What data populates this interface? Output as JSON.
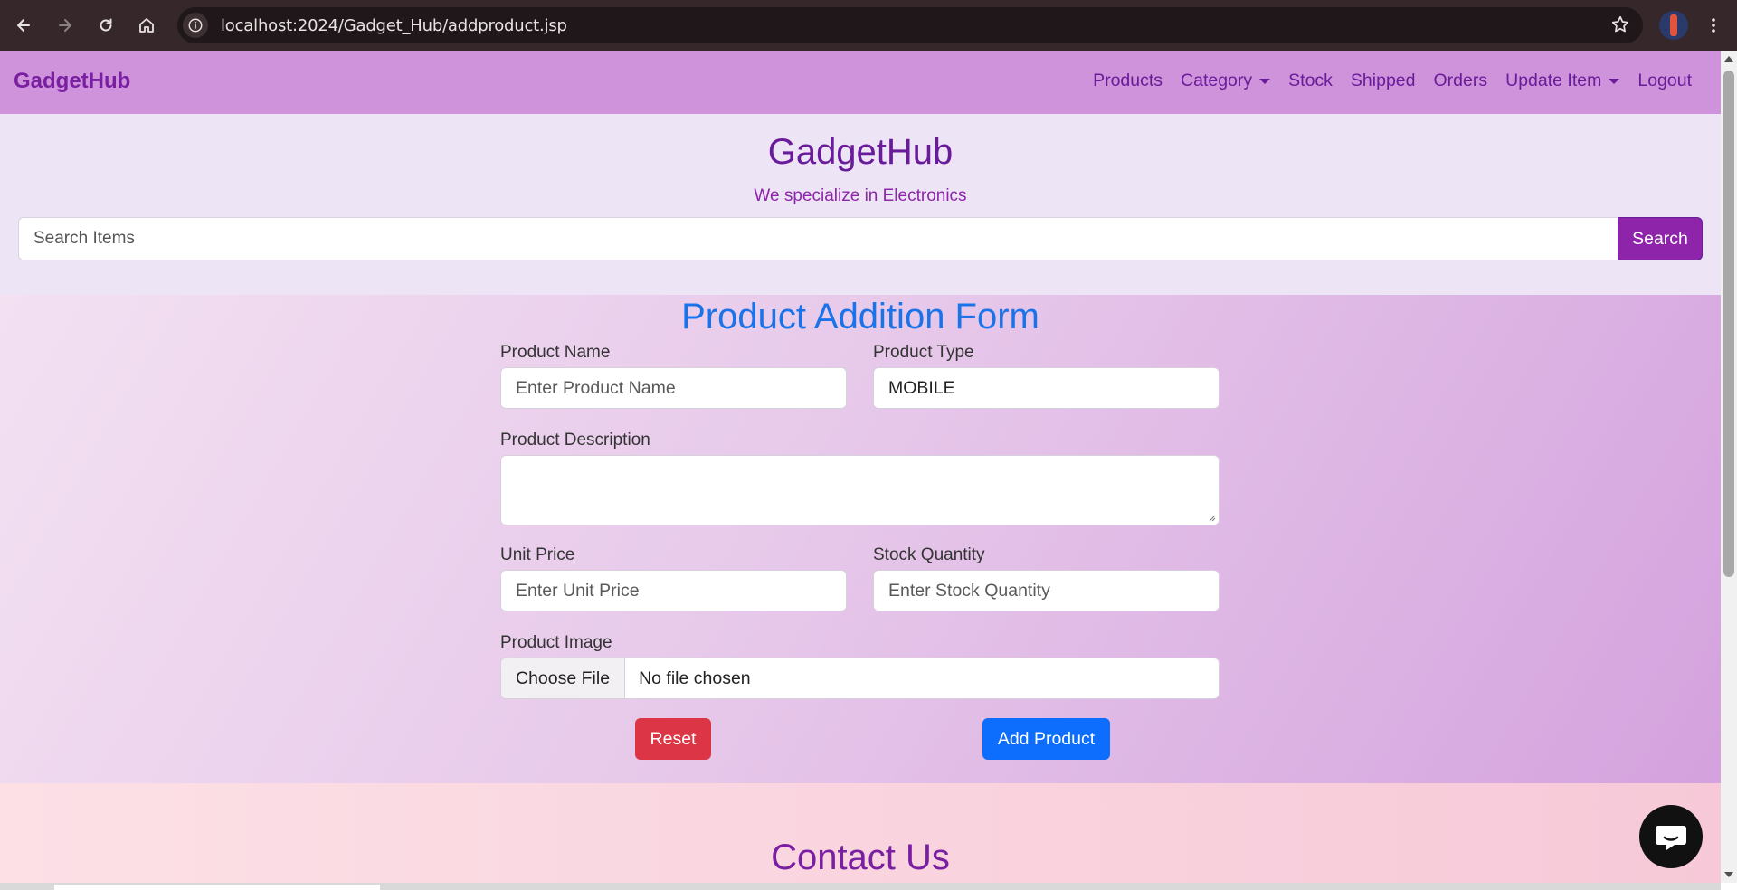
{
  "browser": {
    "url": "localhost:2024/Gadget_Hub/addproduct.jsp"
  },
  "navbar": {
    "brand": "GadgetHub",
    "links": {
      "products": "Products",
      "category": "Category",
      "stock": "Stock",
      "shipped": "Shipped",
      "orders": "Orders",
      "update_item": "Update Item",
      "logout": "Logout"
    }
  },
  "hero": {
    "title": "GadgetHub",
    "subtitle": "We specialize in Electronics",
    "search": {
      "placeholder": "Search Items",
      "button": "Search"
    }
  },
  "form": {
    "title": "Product Addition Form",
    "product_name": {
      "label": "Product Name",
      "placeholder": "Enter Product Name"
    },
    "product_type": {
      "label": "Product Type",
      "value": "MOBILE"
    },
    "product_description": {
      "label": "Product Description"
    },
    "unit_price": {
      "label": "Unit Price",
      "placeholder": "Enter Unit Price"
    },
    "stock_quantity": {
      "label": "Stock Quantity",
      "placeholder": "Enter Stock Quantity"
    },
    "product_image": {
      "label": "Product Image",
      "choose_button": "Choose File",
      "status": "No file chosen"
    },
    "reset_button": "Reset",
    "add_button": "Add Product"
  },
  "contact": {
    "title": "Contact Us"
  },
  "colors": {
    "navbar_bg": "#cf93db",
    "brand": "#7a1fa2",
    "form_title": "#1a73e8",
    "reset": "#dc3545",
    "add": "#0d6efd",
    "search_button": "#8e24aa"
  }
}
